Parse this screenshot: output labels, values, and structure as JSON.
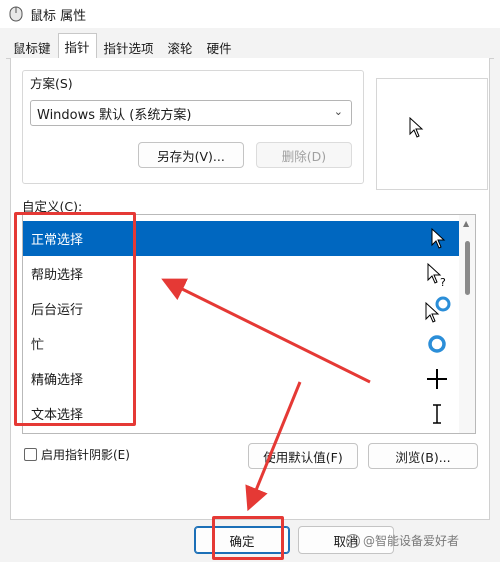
{
  "window": {
    "title": "鼠标 属性"
  },
  "tabs": [
    {
      "label": "鼠标键",
      "active": false
    },
    {
      "label": "指针",
      "active": true
    },
    {
      "label": "指针选项",
      "active": false
    },
    {
      "label": "滚轮",
      "active": false
    },
    {
      "label": "硬件",
      "active": false
    }
  ],
  "scheme": {
    "label": "方案(S)",
    "selected": "Windows 默认 (系统方案)",
    "save_as": "另存为(V)...",
    "delete": "删除(D)"
  },
  "customize": {
    "label": "自定义(C):",
    "items": [
      {
        "label": "正常选择",
        "selected": true,
        "cursor_icon": "arrow-cursor-icon"
      },
      {
        "label": "帮助选择",
        "selected": false,
        "cursor_icon": "help-cursor-icon"
      },
      {
        "label": "后台运行",
        "selected": false,
        "cursor_icon": "working-cursor-icon"
      },
      {
        "label": "忙",
        "selected": false,
        "cursor_icon": "busy-cursor-icon"
      },
      {
        "label": "精确选择",
        "selected": false,
        "cursor_icon": "crosshair-cursor-icon"
      },
      {
        "label": "文本选择",
        "selected": false,
        "cursor_icon": "text-beam-cursor-icon"
      }
    ]
  },
  "shadow_checkbox": {
    "label": "启用指针阴影(E)",
    "checked": false
  },
  "buttons": {
    "use_default": "使用默认值(F)",
    "browse": "浏览(B)...",
    "ok": "确定",
    "cancel": "取消"
  },
  "watermark": {
    "text": "@智能设备爱好者"
  },
  "colors": {
    "selection": "#0067c0",
    "annotation": "#e53935",
    "busy_ring": "#2b8ed8"
  }
}
